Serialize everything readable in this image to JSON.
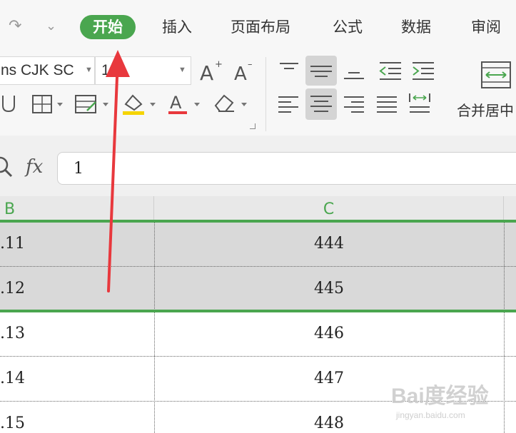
{
  "menu": {
    "tabs": [
      {
        "label": "开始",
        "active": true
      },
      {
        "label": "插入"
      },
      {
        "label": "页面布局"
      },
      {
        "label": "公式"
      },
      {
        "label": "数据"
      },
      {
        "label": "审阅"
      }
    ]
  },
  "ribbon": {
    "font_name": "ns CJK SC",
    "font_size": "1",
    "merge_label": "合并居中"
  },
  "formula_bar": {
    "fx_label": "fx",
    "value": "1"
  },
  "columns": {
    "b": "B",
    "c": "C"
  },
  "rows": [
    {
      "b": ".11",
      "c": "444",
      "selected": true
    },
    {
      "b": ".12",
      "c": "445",
      "selected": true
    },
    {
      "b": ".13",
      "c": "446",
      "selected": false
    },
    {
      "b": ".14",
      "c": "447",
      "selected": false
    },
    {
      "b": ".15",
      "c": "448",
      "selected": false
    }
  ],
  "watermark": {
    "brand": "Bai度经验",
    "url": "jingyan.baidu.com"
  },
  "colors": {
    "accent_green": "#4aa64f",
    "annotation_red": "#e8383d",
    "selection_gray": "#d9d9d9"
  }
}
